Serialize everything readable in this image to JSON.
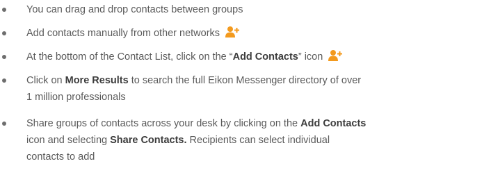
{
  "bullets": [
    {
      "text": "You can drag and drop contacts between groups"
    },
    {
      "text": "Add contacts manually from other networks",
      "icon": "add-contact-icon"
    },
    {
      "before": "At the bottom of the Contact List, click on the “",
      "bold": "Add Contacts",
      "after": "” icon",
      "icon": "add-contact-icon"
    },
    {
      "lead": "Click on ",
      "bold": "More Results",
      "rest1": " to search the full Eikon Messenger directory of over",
      "line2": "1 million professionals"
    },
    {
      "lead": "Share groups of contacts across your desk by clicking on the ",
      "bold1": "Add Contacts",
      "line2_pre": "icon and selecting ",
      "bold2": "Share Contacts.",
      "line2_post": " Recipients can select individual",
      "line3": "contacts to add"
    }
  ],
  "colors": {
    "text": "#5a5a5a",
    "bold": "#3c3c3c",
    "icon": "#f39a1e"
  }
}
